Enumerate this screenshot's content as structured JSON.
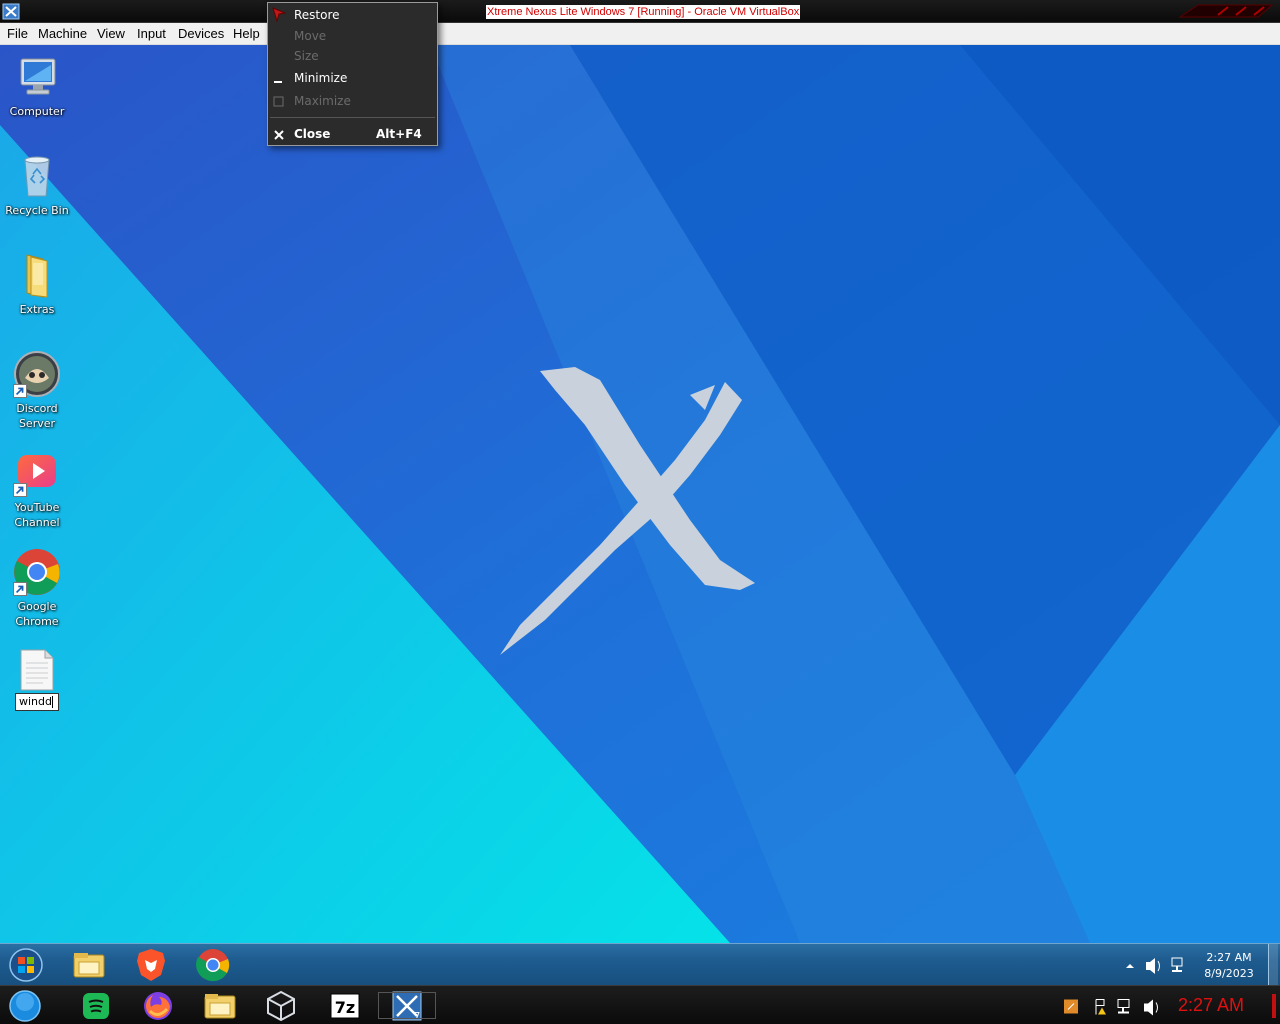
{
  "host_window": {
    "title": "Xtreme Nexus Lite Windows 7 [Running] - Oracle VM VirtualBox",
    "menu": [
      "File",
      "Machine",
      "View",
      "Input",
      "Devices",
      "Help"
    ]
  },
  "system_menu": {
    "items": [
      {
        "label": "Restore",
        "enabled": true,
        "shortcut": ""
      },
      {
        "label": "Move",
        "enabled": false,
        "shortcut": ""
      },
      {
        "label": "Size",
        "enabled": false,
        "shortcut": ""
      },
      {
        "label": "Minimize",
        "enabled": true,
        "shortcut": ""
      },
      {
        "label": "Maximize",
        "enabled": false,
        "shortcut": ""
      },
      {
        "label": "Close",
        "enabled": true,
        "shortcut": "Alt+F4"
      }
    ]
  },
  "desktop": {
    "icons": [
      {
        "label": "Computer",
        "icon": "computer-icon"
      },
      {
        "label": "Recycle Bin",
        "icon": "recycle-bin-icon"
      },
      {
        "label": "Extras",
        "icon": "folder-icon"
      },
      {
        "label": "Discord\nServer",
        "icon": "discord-icon"
      },
      {
        "label": "YouTube\nChannel",
        "icon": "youtube-icon"
      },
      {
        "label": "Google\nChrome",
        "icon": "chrome-icon"
      }
    ],
    "renaming_file": {
      "icon": "text-file-icon",
      "value": "windd"
    }
  },
  "guest_taskbar": {
    "pinned": [
      "start-orb-icon",
      "file-explorer-icon",
      "brave-icon",
      "chrome-icon"
    ],
    "clock_time": "2:27 AM",
    "clock_date": "8/9/2023"
  },
  "host_taskbar": {
    "pinned": [
      "start-orb-icon",
      "spotify-icon",
      "firefox-icon",
      "file-explorer-icon",
      "virtualbox-icon",
      "7zip-icon",
      "windows7-vm-icon"
    ],
    "clock_time": "2:27 AM"
  },
  "colors": {
    "host_title_text": "#d10000",
    "host_clock": "#e01010",
    "desktop_blue": "#1f74d6",
    "desktop_cyan": "#14d5e6"
  }
}
